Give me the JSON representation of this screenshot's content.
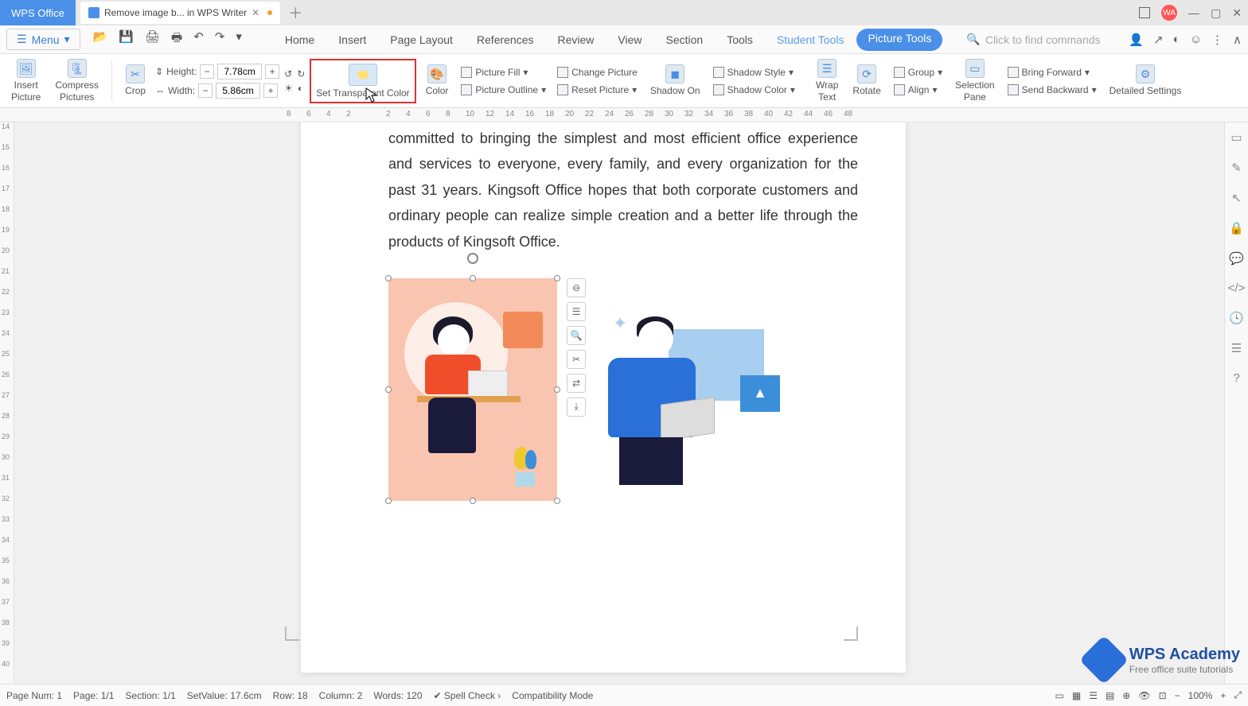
{
  "titlebar": {
    "home_tab": "WPS Office",
    "doc_tab": "Remove image b... in WPS Writer",
    "avatar": "WA"
  },
  "menubar": {
    "menu_label": "Menu",
    "tabs": [
      "Home",
      "Insert",
      "Page Layout",
      "References",
      "Review",
      "View",
      "Section",
      "Tools",
      "Student Tools",
      "Picture Tools"
    ],
    "search_placeholder": "Click to find commands"
  },
  "ribbon": {
    "insert_picture": "Insert\nPicture",
    "compress": "Compress\nPictures",
    "crop": "Crop",
    "height_label": "Height:",
    "height_value": "7.78cm",
    "width_label": "Width:",
    "width_value": "5.86cm",
    "transparent": "Set Transparent Color",
    "color": "Color",
    "picture_fill": "Picture Fill",
    "picture_outline": "Picture Outline",
    "change_picture": "Change Picture",
    "reset_picture": "Reset Picture",
    "shadow_on": "Shadow On",
    "shadow_style": "Shadow Style",
    "shadow_color": "Shadow Color",
    "wrap_text": "Wrap\nText",
    "rotate": "Rotate",
    "group": "Group",
    "align": "Align",
    "selection_pane": "Selection\nPane",
    "bring_forward": "Bring Forward",
    "send_backward": "Send Backward",
    "detailed": "Detailed Settings"
  },
  "ruler_h": [
    "8",
    "6",
    "4",
    "2",
    "",
    "2",
    "4",
    "6",
    "8",
    "10",
    "12",
    "14",
    "16",
    "18",
    "20",
    "22",
    "24",
    "26",
    "28",
    "30",
    "32",
    "34",
    "36",
    "38",
    "40",
    "42",
    "44",
    "46",
    "48"
  ],
  "ruler_v": [
    "14",
    "15",
    "16",
    "17",
    "18",
    "19",
    "20",
    "21",
    "22",
    "23",
    "24",
    "25",
    "26",
    "27",
    "28",
    "29",
    "30",
    "31",
    "32",
    "33",
    "34",
    "35",
    "36",
    "37",
    "38",
    "39",
    "40"
  ],
  "document": {
    "paragraph": "committed to bringing the simplest and most efficient office experience and services to everyone, every family, and every organization for the past 31 years. Kingsoft Office hopes that both corporate customers and ordinary people can realize simple creation and a better life through the products of Kingsoft Office."
  },
  "status": {
    "page_num": "Page Num: 1",
    "page": "Page: 1/1",
    "section": "Section: 1/1",
    "setvalue": "SetValue: 17.6cm",
    "row": "Row: 18",
    "column": "Column: 2",
    "words": "Words: 120",
    "spell": "Spell Check",
    "compat": "Compatibility Mode",
    "zoom": "100%"
  },
  "watermark": {
    "title": "WPS Academy",
    "sub": "Free office suite tutorials"
  }
}
